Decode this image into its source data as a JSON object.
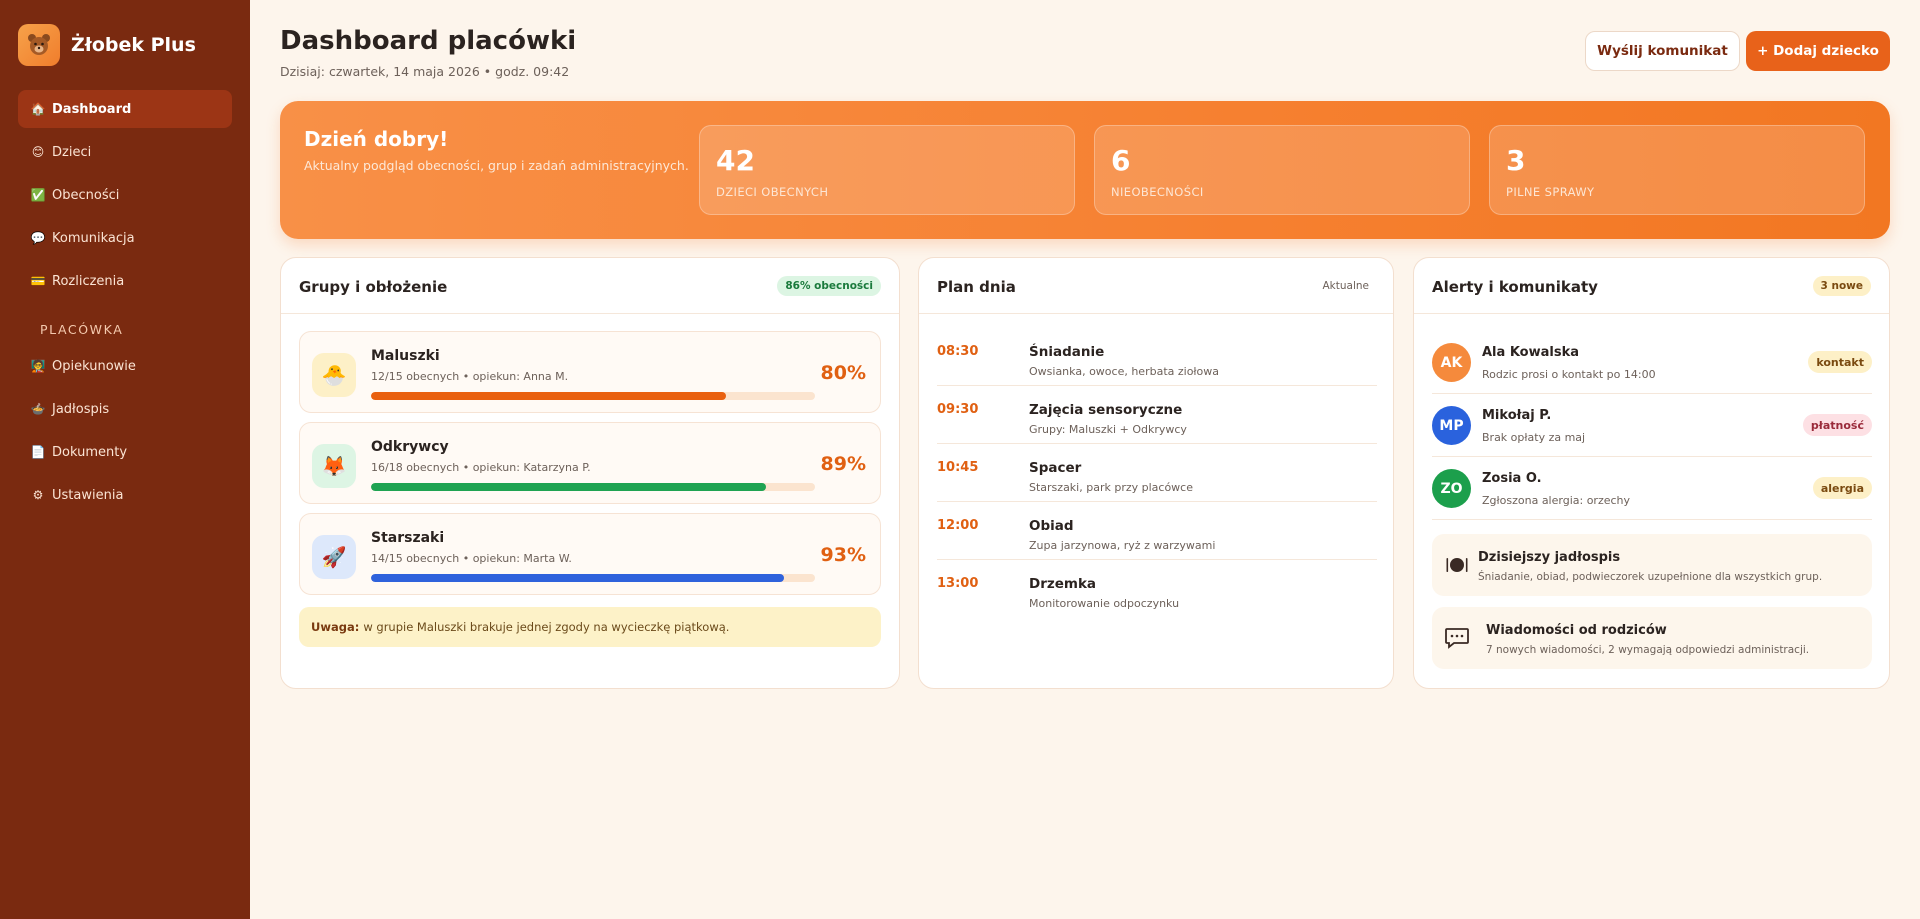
{
  "app": {
    "name": "Żłobek Plus",
    "logo_icon": "teddy-bear-icon"
  },
  "sidebar": {
    "items": [
      {
        "label": "Dashboard",
        "icon": "home-icon",
        "glyph": "🏠",
        "active": true
      },
      {
        "label": "Dzieci",
        "icon": "child-face-icon",
        "glyph": "😊"
      },
      {
        "label": "Obecności",
        "icon": "check-mark-icon",
        "glyph": "✅"
      },
      {
        "label": "Komunikacja",
        "icon": "chat-bubble-icon",
        "glyph": "💬"
      },
      {
        "label": "Rozliczenia",
        "icon": "card-icon",
        "glyph": "💳"
      }
    ],
    "section_label": "PLACÓWKA",
    "section_items": [
      {
        "label": "Opiekunowie",
        "icon": "teacher-icon",
        "glyph": "🧑‍🏫"
      },
      {
        "label": "Jadłospis",
        "icon": "bowl-icon",
        "glyph": "🍲"
      },
      {
        "label": "Dokumenty",
        "icon": "document-icon",
        "glyph": "📄"
      },
      {
        "label": "Ustawienia",
        "icon": "gear-icon",
        "glyph": "⚙"
      }
    ]
  },
  "header": {
    "title": "Dashboard placówki",
    "date_line": "Dzisiaj: czwartek, 14 maja 2026 • godz. 09:42",
    "send_message_button": "Wyślij komunikat",
    "add_child_button": "+ Dodaj dziecko"
  },
  "hero": {
    "greeting": "Dzień dobry!",
    "subtitle": "Aktualny podgląd obecności, grup i zadań administracyjnych.",
    "stats": [
      {
        "value": "42",
        "label": "DZIECI OBECNYCH"
      },
      {
        "value": "6",
        "label": "NIEOBECNOŚCI"
      },
      {
        "value": "3",
        "label": "PILNE SPRAWY"
      }
    ]
  },
  "groups": {
    "title": "Grupy i obłożenie",
    "badge": "86% obecności",
    "items": [
      {
        "name": "Maluszki",
        "meta": "12/15 obecnych • opiekun: Anna M.",
        "percent": "80%",
        "fill": 0.8,
        "color": "#e9600f",
        "icon": "hatching-chick-icon",
        "glyph": "🐣",
        "icon_bg": "#fdf0c7"
      },
      {
        "name": "Odkrywcy",
        "meta": "16/18 obecnych • opiekun: Katarzyna P.",
        "percent": "89%",
        "fill": 0.89,
        "color": "#1fa352",
        "icon": "fox-icon",
        "glyph": "🦊",
        "icon_bg": "#ddf5e4"
      },
      {
        "name": "Starszaki",
        "meta": "14/15 obecnych • opiekun: Marta W.",
        "percent": "93%",
        "fill": 0.93,
        "color": "#2f62dc",
        "icon": "rocket-icon",
        "glyph": "🚀",
        "icon_bg": "#dde8fb"
      }
    ],
    "warning_strong": "Uwaga:",
    "warning_text": "w grupie Maluszki brakuje jednej zgody na wycieczkę piątkową."
  },
  "plan": {
    "title": "Plan dnia",
    "badge": "Aktualne",
    "items": [
      {
        "time": "08:30",
        "title": "Śniadanie",
        "desc": "Owsianka, owoce, herbata ziołowa"
      },
      {
        "time": "09:30",
        "title": "Zajęcia sensoryczne",
        "desc": "Grupy: Maluszki + Odkrywcy"
      },
      {
        "time": "10:45",
        "title": "Spacer",
        "desc": "Starszaki, park przy placówce"
      },
      {
        "time": "12:00",
        "title": "Obiad",
        "desc": "Zupa jarzynowa, ryż z warzywami"
      },
      {
        "time": "13:00",
        "title": "Drzemka",
        "desc": "Monitorowanie odpoczynku"
      }
    ]
  },
  "alerts": {
    "title": "Alerty i komunikaty",
    "badge": "3 nowe",
    "items": [
      {
        "initials": "AK",
        "name": "Ala Kowalska",
        "desc": "Rodzic prosi o kontakt po 14:00",
        "tag": "kontakt",
        "avatar_color": "#f58a3c",
        "tag_bg": "#fdf0c7",
        "tag_color": "#7a4a10"
      },
      {
        "initials": "MP",
        "name": "Mikołaj P.",
        "desc": "Brak opłaty za maj",
        "tag": "płatność",
        "avatar_color": "#2a62dd",
        "tag_bg": "#fde0e4",
        "tag_color": "#9a2a3a"
      },
      {
        "initials": "ZO",
        "name": "Zosia O.",
        "desc": "Zgłoszona alergia: orzechy",
        "tag": "alergia",
        "avatar_color": "#1c9f4c",
        "tag_bg": "#fdf0c7",
        "tag_color": "#7a4a10"
      }
    ],
    "menu_box": {
      "title": "Dzisiejszy jadłospis",
      "desc": "Śniadanie, obiad, podwieczorek uzupełnione dla wszystkich grup.",
      "icon": "plate-cutlery-icon"
    },
    "messages_box": {
      "title": "Wiadomości od rodziców",
      "desc": "7 nowych wiadomości, 2 wymagają odpowiedzi administracji.",
      "icon": "speech-bubble-icon"
    }
  }
}
